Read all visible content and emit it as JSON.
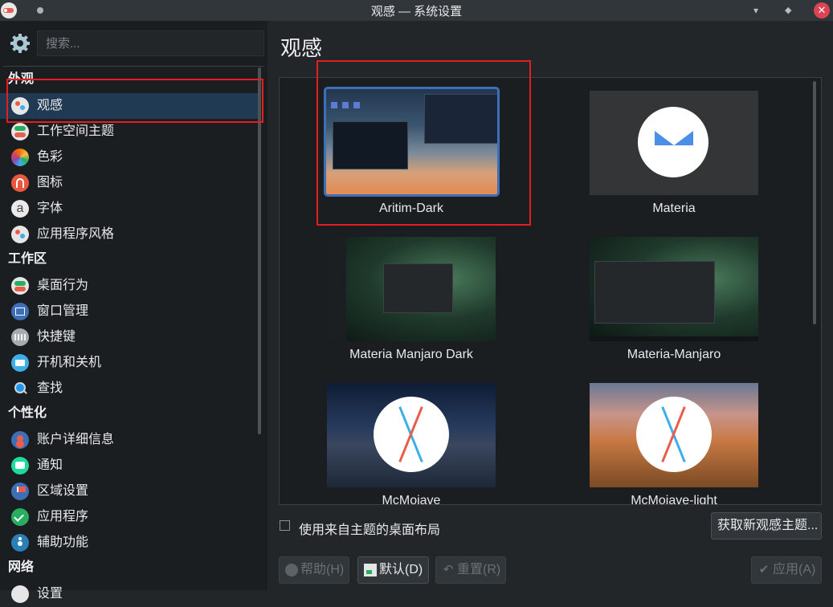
{
  "window": {
    "title": "观感 — 系统设置",
    "minimize_glyph": "▾",
    "maximize_glyph": "◆",
    "close_glyph": "✕"
  },
  "sidebar": {
    "search": {
      "placeholder": "搜索..."
    },
    "categories": [
      {
        "label": "外观",
        "items": [
          {
            "label": "观感",
            "icon": "appearance-icon",
            "selected": true
          },
          {
            "label": "工作空间主题",
            "icon": "workspace-theme-icon"
          },
          {
            "label": "色彩",
            "icon": "colors-icon"
          },
          {
            "label": "图标",
            "icon": "icons-icon"
          },
          {
            "label": "字体",
            "icon": "fonts-icon",
            "glyph": "a"
          },
          {
            "label": "应用程序风格",
            "icon": "app-style-icon"
          }
        ]
      },
      {
        "label": "工作区",
        "items": [
          {
            "label": "桌面行为",
            "icon": "desktop-behavior-icon"
          },
          {
            "label": "窗口管理",
            "icon": "window-management-icon"
          },
          {
            "label": "快捷键",
            "icon": "shortcuts-icon"
          },
          {
            "label": "开机和关机",
            "icon": "startup-shutdown-icon"
          },
          {
            "label": "查找",
            "icon": "search-settings-icon"
          }
        ]
      },
      {
        "label": "个性化",
        "items": [
          {
            "label": "账户详细信息",
            "icon": "account-icon"
          },
          {
            "label": "通知",
            "icon": "notifications-icon"
          },
          {
            "label": "区域设置",
            "icon": "region-icon"
          },
          {
            "label": "应用程序",
            "icon": "applications-icon"
          },
          {
            "label": "辅助功能",
            "icon": "accessibility-icon"
          }
        ]
      },
      {
        "label": "网络",
        "items": [
          {
            "label": "设置",
            "icon": "network-settings-icon"
          }
        ]
      }
    ]
  },
  "main": {
    "title": "观感",
    "themes": [
      {
        "name": "Aritim-Dark",
        "selected": true
      },
      {
        "name": "Materia"
      },
      {
        "name": "Materia Manjaro Dark"
      },
      {
        "name": "Materia-Manjaro"
      },
      {
        "name": "McMojave"
      },
      {
        "name": "McMojave-light"
      }
    ],
    "use_layout_checkbox": {
      "label": "使用来自主题的桌面布局",
      "checked": false
    },
    "get_new_button": "获取新观感主题...",
    "buttons": {
      "help": "帮助(H)",
      "default": "默认(D)",
      "reset": "重置(R)",
      "apply": "应用(A)"
    }
  },
  "colors": {
    "accent": "#3daee9",
    "selection": "#1f3a52",
    "highlight_box": "#e41e1e"
  }
}
